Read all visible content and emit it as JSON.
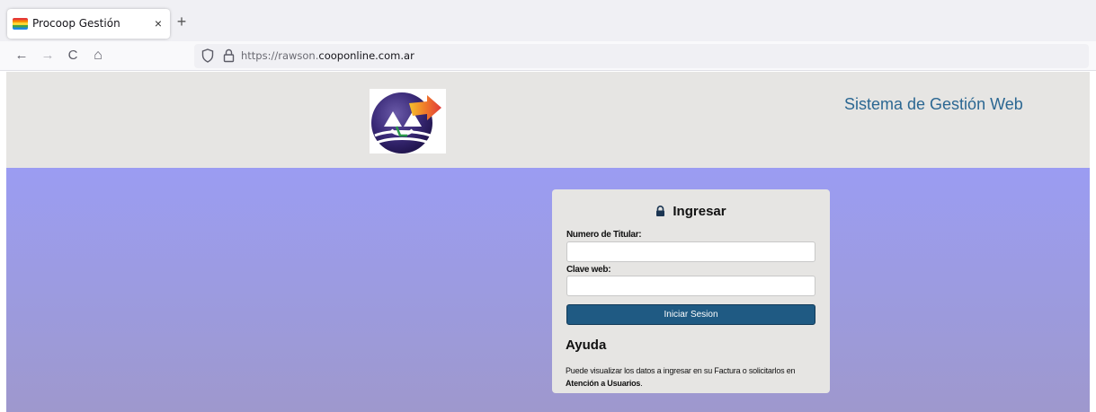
{
  "browser": {
    "tab_title": "Procoop Gestión",
    "tab_close": "×",
    "new_tab": "+",
    "url_prefix": "https://rawson.",
    "url_domain": "cooponline.com.ar",
    "nav": {
      "back": "←",
      "forward": "→",
      "reload": "C",
      "home": "⌂"
    }
  },
  "header": {
    "site_title": "Sistema de Gestión Web"
  },
  "login": {
    "heading": "Ingresar",
    "titular_label": "Numero de Titular:",
    "titular_value": "",
    "clave_label": "Clave web:",
    "clave_value": "",
    "submit_label": "Iniciar Sesion"
  },
  "help": {
    "title": "Ayuda",
    "text": "Puede visualizar los datos a ingresar en su Factura o solicitarlos en",
    "link": "Atención a Usuarios",
    "suffix": "."
  },
  "colors": {
    "header_bg": "#e6e5e3",
    "body_bg_top": "#9b9cf2",
    "body_bg_bottom": "#9e98cd",
    "title_color": "#2b6792",
    "button_bg": "#1f5a83"
  },
  "icons": [
    "procoop-favicon-icon",
    "shield-icon",
    "lock-icon",
    "padlock-icon",
    "procoop-logo"
  ]
}
